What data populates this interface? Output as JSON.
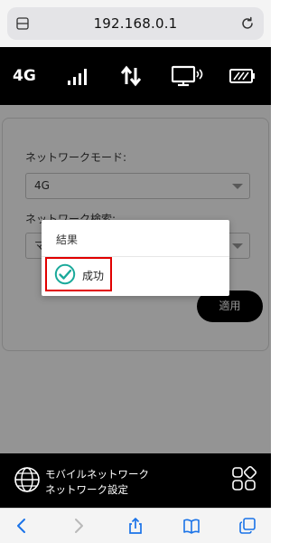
{
  "browser": {
    "url": "192.168.0.1"
  },
  "status_bar": {
    "network_type": "4G",
    "icons": [
      "signal-icon",
      "data-transfer-icon",
      "wifi-display-icon",
      "battery-icon"
    ]
  },
  "settings": {
    "network_mode_label": "ネットワークモード:",
    "network_mode_value": "4G",
    "network_search_label": "ネットワーク検索:",
    "network_search_value": "マ",
    "apply_label": "適用"
  },
  "dialog": {
    "title": "結果",
    "result_text": "成功",
    "icon": "success-check-icon"
  },
  "bottom_bar": {
    "line1": "モバイルネットワーク",
    "line2": "ネットワーク設定"
  },
  "colors": {
    "accent_teal": "#1aa99a",
    "highlight_red": "#e10000"
  },
  "toolbar": {
    "icons": [
      "back-icon",
      "forward-icon",
      "share-icon",
      "bookmarks-icon",
      "tabs-icon"
    ]
  }
}
